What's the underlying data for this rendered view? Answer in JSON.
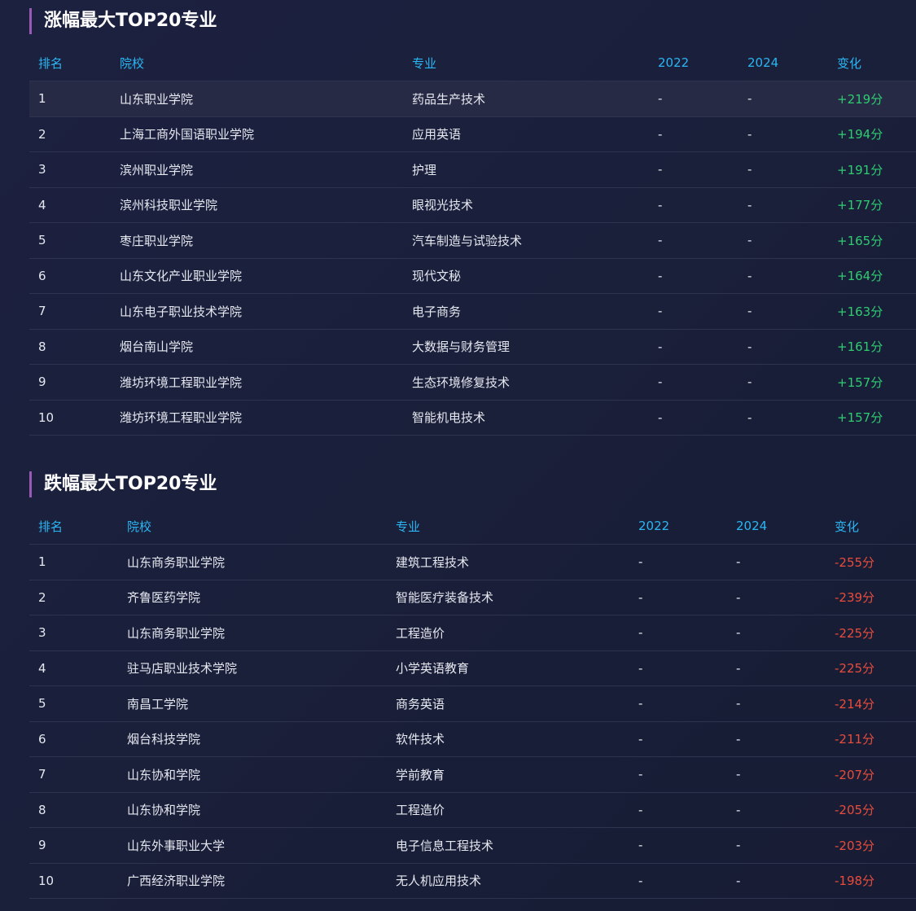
{
  "rise": {
    "title": "涨幅最大TOP20专业",
    "headers": {
      "rank": "排名",
      "school": "院校",
      "major": "专业",
      "y2022": "2022",
      "y2024": "2024",
      "change": "变化"
    },
    "rows": [
      {
        "rank": "1",
        "school": "山东职业学院",
        "major": "药品生产技术",
        "y2022": "-",
        "y2024": "-",
        "change": "+219分"
      },
      {
        "rank": "2",
        "school": "上海工商外国语职业学院",
        "major": "应用英语",
        "y2022": "-",
        "y2024": "-",
        "change": "+194分"
      },
      {
        "rank": "3",
        "school": "滨州职业学院",
        "major": "护理",
        "y2022": "-",
        "y2024": "-",
        "change": "+191分"
      },
      {
        "rank": "4",
        "school": "滨州科技职业学院",
        "major": "眼视光技术",
        "y2022": "-",
        "y2024": "-",
        "change": "+177分"
      },
      {
        "rank": "5",
        "school": "枣庄职业学院",
        "major": "汽车制造与试验技术",
        "y2022": "-",
        "y2024": "-",
        "change": "+165分"
      },
      {
        "rank": "6",
        "school": "山东文化产业职业学院",
        "major": "现代文秘",
        "y2022": "-",
        "y2024": "-",
        "change": "+164分"
      },
      {
        "rank": "7",
        "school": "山东电子职业技术学院",
        "major": "电子商务",
        "y2022": "-",
        "y2024": "-",
        "change": "+163分"
      },
      {
        "rank": "8",
        "school": "烟台南山学院",
        "major": "大数据与财务管理",
        "y2022": "-",
        "y2024": "-",
        "change": "+161分"
      },
      {
        "rank": "9",
        "school": "潍坊环境工程职业学院",
        "major": "生态环境修复技术",
        "y2022": "-",
        "y2024": "-",
        "change": "+157分"
      },
      {
        "rank": "10",
        "school": "潍坊环境工程职业学院",
        "major": "智能机电技术",
        "y2022": "-",
        "y2024": "-",
        "change": "+157分"
      }
    ]
  },
  "fall": {
    "title": "跌幅最大TOP20专业",
    "headers": {
      "rank": "排名",
      "school": "院校",
      "major": "专业",
      "y2022": "2022",
      "y2024": "2024",
      "change": "变化"
    },
    "rows": [
      {
        "rank": "1",
        "school": "山东商务职业学院",
        "major": "建筑工程技术",
        "y2022": "-",
        "y2024": "-",
        "change": "-255分"
      },
      {
        "rank": "2",
        "school": "齐鲁医药学院",
        "major": "智能医疗装备技术",
        "y2022": "-",
        "y2024": "-",
        "change": "-239分"
      },
      {
        "rank": "3",
        "school": "山东商务职业学院",
        "major": "工程造价",
        "y2022": "-",
        "y2024": "-",
        "change": "-225分"
      },
      {
        "rank": "4",
        "school": "驻马店职业技术学院",
        "major": "小学英语教育",
        "y2022": "-",
        "y2024": "-",
        "change": "-225分"
      },
      {
        "rank": "5",
        "school": "南昌工学院",
        "major": "商务英语",
        "y2022": "-",
        "y2024": "-",
        "change": "-214分"
      },
      {
        "rank": "6",
        "school": "烟台科技学院",
        "major": "软件技术",
        "y2022": "-",
        "y2024": "-",
        "change": "-211分"
      },
      {
        "rank": "7",
        "school": "山东协和学院",
        "major": "学前教育",
        "y2022": "-",
        "y2024": "-",
        "change": "-207分"
      },
      {
        "rank": "8",
        "school": "山东协和学院",
        "major": "工程造价",
        "y2022": "-",
        "y2024": "-",
        "change": "-205分"
      },
      {
        "rank": "9",
        "school": "山东外事职业大学",
        "major": "电子信息工程技术",
        "y2022": "-",
        "y2024": "-",
        "change": "-203分"
      },
      {
        "rank": "10",
        "school": "广西经济职业学院",
        "major": "无人机应用技术",
        "y2022": "-",
        "y2024": "-",
        "change": "-198分"
      }
    ]
  },
  "colors": {
    "header_text": "#2bb6f3",
    "positive": "#2ecc71",
    "negative": "#e74c3c",
    "accent_bar": "#9b59b6"
  }
}
